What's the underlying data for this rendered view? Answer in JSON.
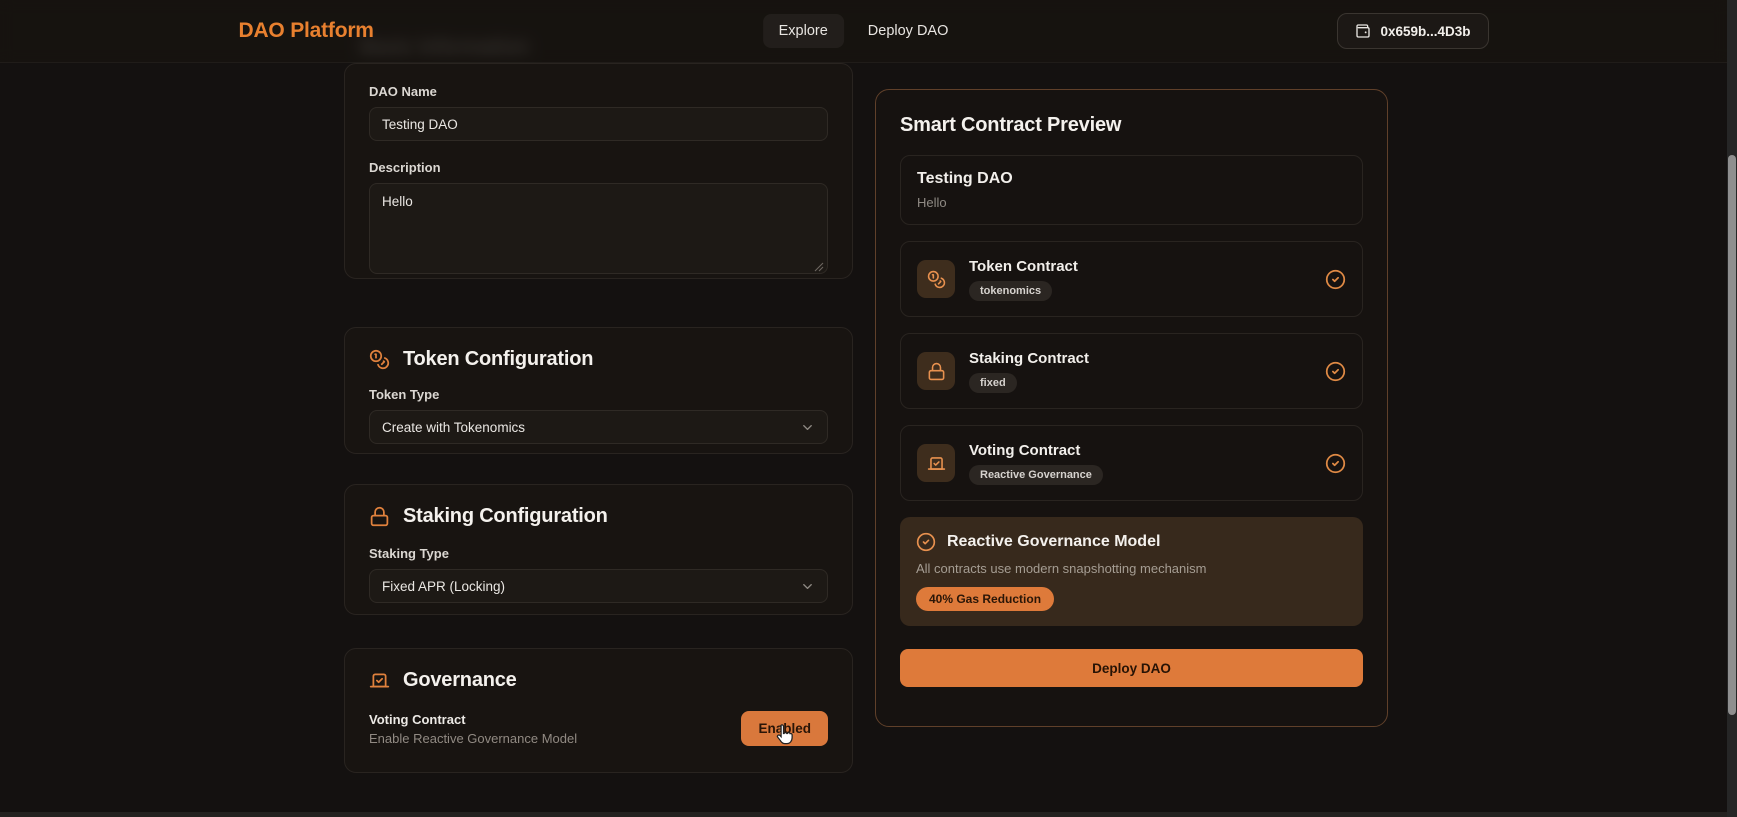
{
  "navbar": {
    "brand": "DAO Platform",
    "links": [
      {
        "label": "Explore"
      },
      {
        "label": "Deploy DAO"
      }
    ],
    "wallet": {
      "icon": "wallet-icon",
      "address": "0x659b...4D3b"
    }
  },
  "form": {
    "basic": {
      "title": "Basic Information",
      "dao_name_label": "DAO Name",
      "dao_name_value": "Testing DAO",
      "description_label": "Description",
      "description_value": "Hello"
    },
    "token": {
      "icon": "coins-icon",
      "title": "Token Configuration",
      "type_label": "Token Type",
      "type_value": "Create with Tokenomics"
    },
    "staking": {
      "icon": "lock-icon",
      "title": "Staking Configuration",
      "type_label": "Staking Type",
      "type_value": "Fixed APR (Locking)"
    },
    "governance": {
      "icon": "vote-icon",
      "title": "Governance",
      "row_title": "Voting Contract",
      "row_subtitle": "Enable Reactive Governance Model",
      "toggle_label": "Enabled"
    }
  },
  "preview": {
    "title": "Smart Contract Preview",
    "dao": {
      "name": "Testing DAO",
      "description": "Hello"
    },
    "contracts": [
      {
        "icon": "coins-icon",
        "name": "Token Contract",
        "badge": "tokenomics",
        "status_icon": "check-circle-icon"
      },
      {
        "icon": "lock-icon",
        "name": "Staking Contract",
        "badge": "fixed",
        "status_icon": "check-circle-icon"
      },
      {
        "icon": "vote-icon",
        "name": "Voting Contract",
        "badge": "Reactive Governance",
        "status_icon": "check-circle-icon"
      }
    ],
    "model": {
      "icon": "check-circle-icon",
      "title": "Reactive Governance Model",
      "subtitle": "All contracts use modern snapshotting mechanism",
      "badge": "40% Gas Reduction"
    },
    "deploy_label": "Deploy DAO"
  },
  "colors": {
    "accent": "#de7a3a",
    "brand": "#e8802f",
    "page_bg": "#141110",
    "card_bg": "#181411",
    "panel_border": "#60402a",
    "model_box_bg": "#37291c",
    "badge_bg": "#2b2622"
  }
}
